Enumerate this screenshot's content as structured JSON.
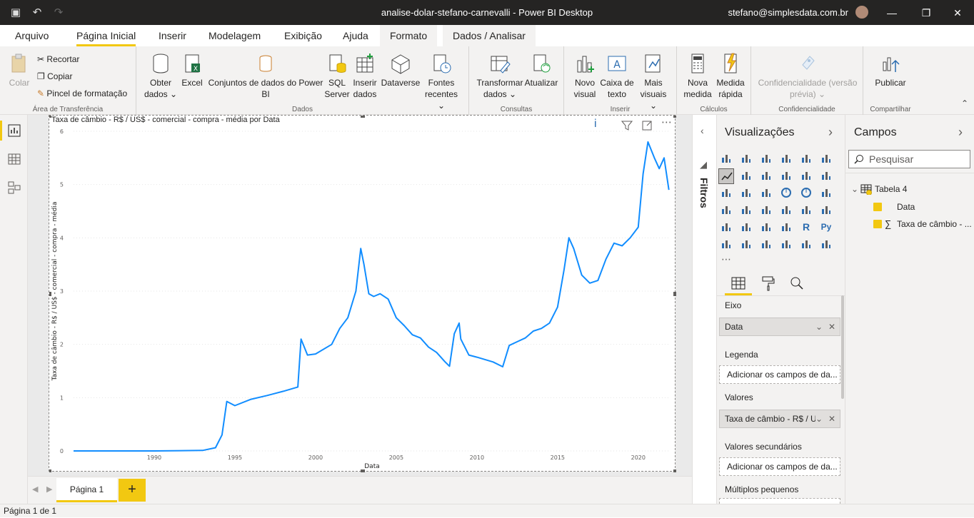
{
  "window": {
    "title": "analise-dolar-stefano-carnevalli - Power BI Desktop",
    "user": "stefano@simplesdata.com.br"
  },
  "tabs": [
    "Arquivo",
    "Página Inicial",
    "Inserir",
    "Modelagem",
    "Exibição",
    "Ajuda",
    "Formato",
    "Dados / Analisar"
  ],
  "ribbon": {
    "clipboard": {
      "paste": "Colar",
      "cut": "Recortar",
      "copy": "Copiar",
      "format_painter": "Pincel de formatação",
      "label": "Área de Transferência"
    },
    "data": {
      "get_data_1": "Obter",
      "get_data_2": "dados ⌄",
      "excel": "Excel",
      "datasets_1": "Conjuntos de dados do Power",
      "datasets_2": "BI",
      "sql_1": "SQL",
      "sql_2": "Server",
      "enter_1": "Inserir",
      "enter_2": "dados",
      "dataverse": "Dataverse",
      "recent_1": "Fontes",
      "recent_2": "recentes ⌄",
      "label": "Dados"
    },
    "queries": {
      "transform_1": "Transformar",
      "transform_2": "dados ⌄",
      "refresh": "Atualizar",
      "label": "Consultas"
    },
    "insert": {
      "new_visual_1": "Novo",
      "new_visual_2": "visual",
      "textbox_1": "Caixa de",
      "textbox_2": "texto",
      "more_1": "Mais",
      "more_2": "visuais ⌄",
      "label": "Inserir"
    },
    "calc": {
      "measure_1": "Nova",
      "measure_2": "medida",
      "quick_1": "Medida",
      "quick_2": "rápida",
      "label": "Cálculos"
    },
    "sens": {
      "line1": "Confidencialidade (versão",
      "line2": "prévia) ⌄",
      "label": "Confidencialidade"
    },
    "share": {
      "publish": "Publicar",
      "label": "Compartilhar"
    }
  },
  "pages": {
    "tab": "Página 1",
    "add": "+",
    "status": "Página 1 de 1"
  },
  "filters_label": "Filtros",
  "visualizations": {
    "title": "Visualizações",
    "wells": {
      "axis": "Eixo",
      "axis_value": "Data",
      "legend": "Legenda",
      "legend_ph": "Adicionar os campos de da...",
      "values": "Valores",
      "values_value": "Taxa de câmbio - R$ / U",
      "secondary": "Valores secundários",
      "secondary_ph": "Adicionar os campos de da...",
      "multiples": "Múltiplos pequenos"
    }
  },
  "fields": {
    "title": "Campos",
    "search_placeholder": "Pesquisar",
    "table": "Tabela 4",
    "items": [
      "Data",
      "Taxa de câmbio - ..."
    ]
  },
  "colors": {
    "accent": "#f2c811",
    "line": "#118dff"
  },
  "chart_data": {
    "type": "line",
    "title": "Taxa de câmbio - R$ / US$ - comercial - compra - média por Data",
    "xlabel": "Data",
    "ylabel": "Taxa de câmbio - R$ / US$ - comercial - compra - média",
    "x_ticks": [
      1990,
      1995,
      2000,
      2005,
      2010,
      2015,
      2020
    ],
    "y_ticks": [
      0,
      1,
      2,
      3,
      4,
      5,
      6
    ],
    "xlim": [
      1985,
      2022
    ],
    "ylim": [
      0,
      6
    ],
    "series": [
      {
        "x": [
          1985,
          1990,
          1993,
          1993.8,
          1994.2,
          1994.5,
          1995,
          1996,
          1997,
          1998,
          1998.9,
          1999.1,
          1999.5,
          2000,
          2001,
          2001.5,
          2002,
          2002.5,
          2002.8,
          2003,
          2003.3,
          2003.6,
          2004,
          2004.5,
          2005,
          2005.5,
          2006,
          2006.5,
          2007,
          2007.5,
          2008,
          2008.3,
          2008.6,
          2008.9,
          2009,
          2009.5,
          2010,
          2011,
          2011.6,
          2012,
          2012.5,
          2013,
          2013.5,
          2014,
          2014.5,
          2015,
          2015.4,
          2015.7,
          2016,
          2016.5,
          2017,
          2017.5,
          2018,
          2018.5,
          2019,
          2019.5,
          2020,
          2020.3,
          2020.6,
          2021,
          2021.3,
          2021.6,
          2021.9
        ],
        "values": [
          0,
          0,
          0.01,
          0.06,
          0.3,
          0.93,
          0.85,
          0.97,
          1.04,
          1.12,
          1.2,
          2.1,
          1.8,
          1.82,
          2.0,
          2.3,
          2.5,
          3.0,
          3.8,
          3.5,
          2.95,
          2.9,
          2.95,
          2.85,
          2.5,
          2.35,
          2.18,
          2.12,
          1.95,
          1.85,
          1.68,
          1.59,
          2.2,
          2.4,
          2.1,
          1.8,
          1.76,
          1.67,
          1.58,
          1.98,
          2.05,
          2.12,
          2.25,
          2.3,
          2.4,
          2.7,
          3.4,
          4.0,
          3.8,
          3.3,
          3.15,
          3.2,
          3.6,
          3.9,
          3.85,
          4.0,
          4.2,
          5.2,
          5.8,
          5.5,
          5.3,
          5.5,
          4.9
        ]
      }
    ]
  }
}
